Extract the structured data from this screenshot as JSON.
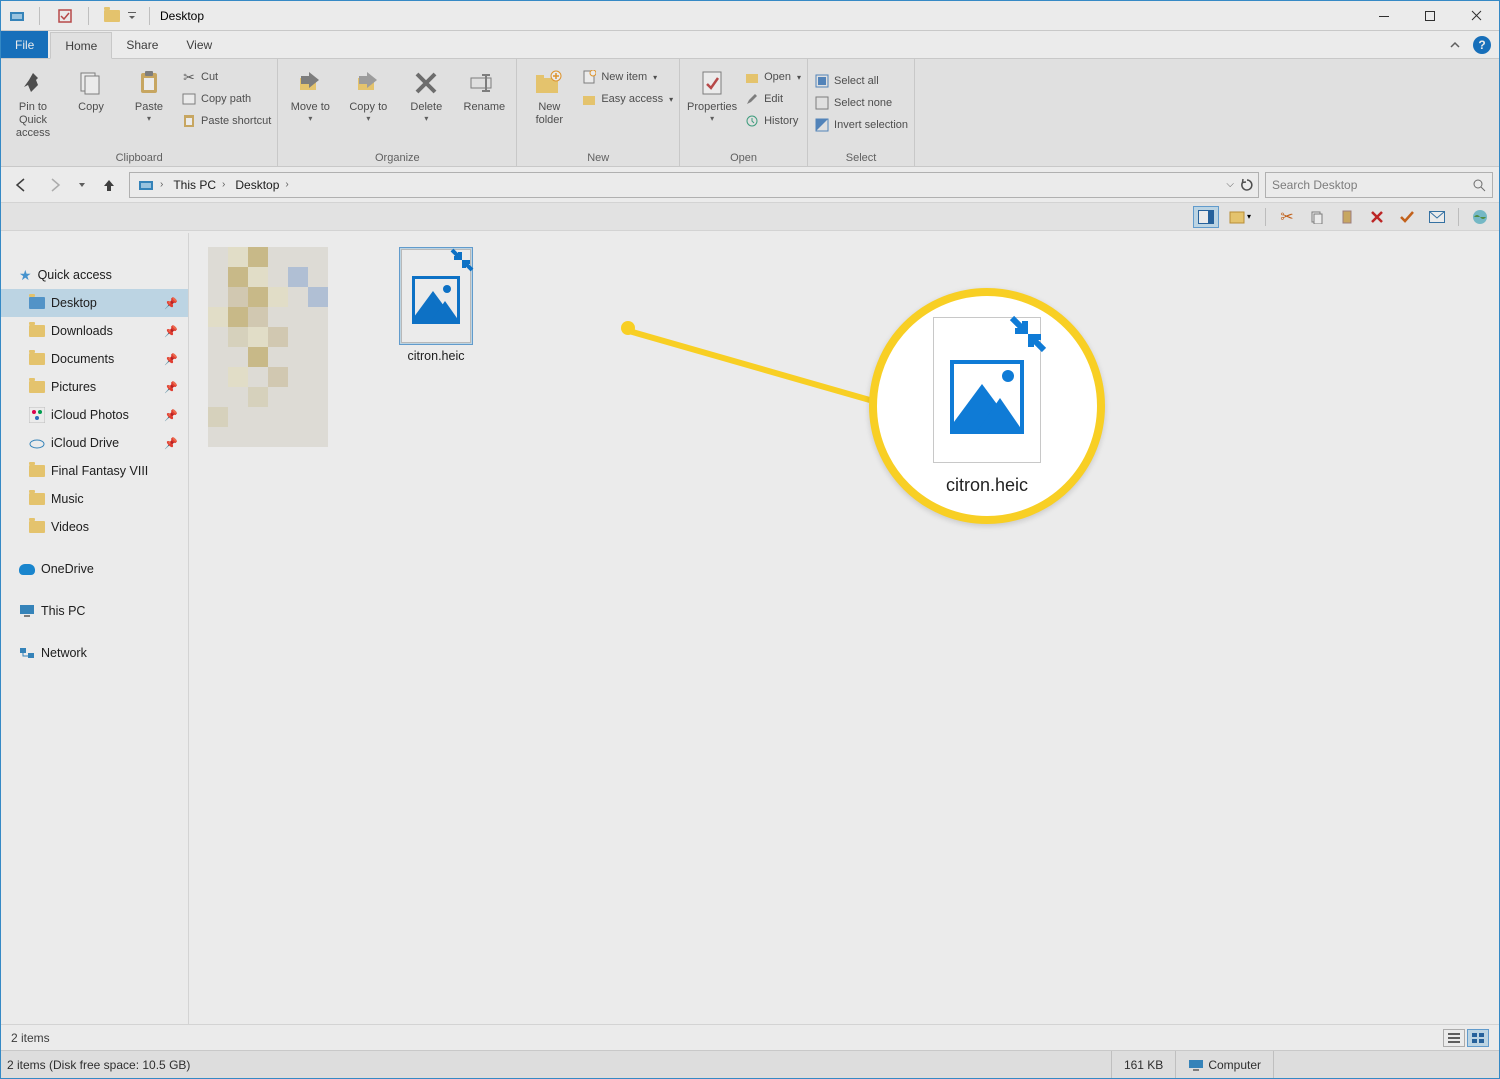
{
  "window": {
    "title": "Desktop"
  },
  "tabs": {
    "file": "File",
    "home": "Home",
    "share": "Share",
    "view": "View"
  },
  "ribbon": {
    "clipboard": {
      "label": "Clipboard",
      "pin": "Pin to Quick access",
      "copy": "Copy",
      "paste": "Paste",
      "cut": "Cut",
      "copypath": "Copy path",
      "pastesc": "Paste shortcut"
    },
    "organize": {
      "label": "Organize",
      "moveto": "Move to",
      "copyto": "Copy to",
      "delete": "Delete",
      "rename": "Rename"
    },
    "new": {
      "label": "New",
      "newfolder": "New folder",
      "newitem": "New item",
      "easyaccess": "Easy access"
    },
    "open": {
      "label": "Open",
      "properties": "Properties",
      "open": "Open",
      "edit": "Edit",
      "history": "History"
    },
    "select": {
      "label": "Select",
      "all": "Select all",
      "none": "Select none",
      "invert": "Invert selection"
    }
  },
  "breadcrumb": {
    "thispc": "This PC",
    "desktop": "Desktop"
  },
  "search": {
    "placeholder": "Search Desktop"
  },
  "sidebar": {
    "quick": "Quick access",
    "items": [
      "Desktop",
      "Downloads",
      "Documents",
      "Pictures",
      "iCloud Photos",
      "iCloud Drive",
      "Final Fantasy VIII",
      "Music",
      "Videos"
    ],
    "onedrive": "OneDrive",
    "thispc": "This PC",
    "network": "Network"
  },
  "files": {
    "heic": "citron.heic"
  },
  "callout": {
    "name": "citron.heic"
  },
  "status": {
    "items": "2 items",
    "line2": "2 items (Disk free space: 10.5 GB)",
    "size": "161 KB",
    "computer": "Computer"
  }
}
